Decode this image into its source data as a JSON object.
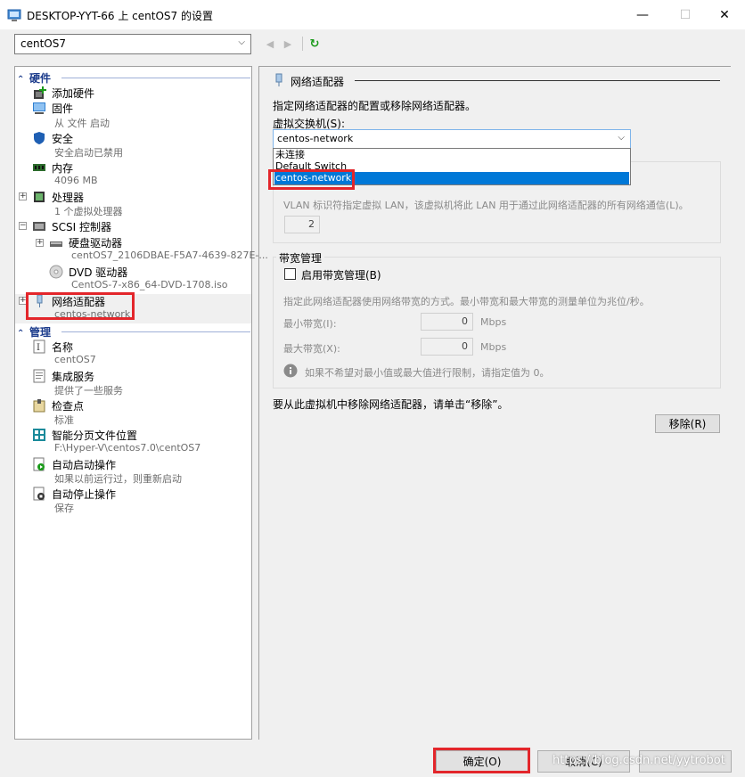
{
  "window": {
    "title": "DESKTOP-YYT-66 上 centOS7 的设置",
    "minimize": "—",
    "maximize": "☐",
    "close": "✕"
  },
  "toolbar": {
    "vm_name": "centOS7",
    "back": "◀",
    "forward": "▶",
    "refresh": "↻"
  },
  "left": {
    "hardware_header": "硬件",
    "management_header": "管理",
    "hardware_items": [
      {
        "label": "添加硬件",
        "sub": "",
        "icon": "add-hardware-icon"
      },
      {
        "label": "固件",
        "sub": "从 文件 启动",
        "icon": "firmware-icon"
      },
      {
        "label": "安全",
        "sub": "安全启动已禁用",
        "icon": "shield-icon"
      },
      {
        "label": "内存",
        "sub": "4096 MB",
        "icon": "memory-icon"
      },
      {
        "label": "处理器",
        "sub": "1 个虚拟处理器",
        "icon": "processor-icon"
      },
      {
        "label": "SCSI 控制器",
        "sub": "",
        "icon": "scsi-controller-icon"
      },
      {
        "label": "硬盘驱动器",
        "sub": "centOS7_2106DBAE-F5A7-4639-827E-...",
        "icon": "hard-drive-icon"
      },
      {
        "label": "DVD 驱动器",
        "sub": "CentOS-7-x86_64-DVD-1708.iso",
        "icon": "dvd-drive-icon"
      },
      {
        "label": "网络适配器",
        "sub": "centos-network",
        "icon": "network-adapter-icon"
      }
    ],
    "management_items": [
      {
        "label": "名称",
        "sub": "centOS7",
        "icon": "name-icon"
      },
      {
        "label": "集成服务",
        "sub": "提供了一些服务",
        "icon": "integration-services-icon"
      },
      {
        "label": "检查点",
        "sub": "标准",
        "icon": "checkpoint-icon"
      },
      {
        "label": "智能分页文件位置",
        "sub": "F:\\Hyper-V\\centos7.0\\centOS7",
        "icon": "paging-file-icon"
      },
      {
        "label": "自动启动操作",
        "sub": "如果以前运行过，则重新启动",
        "icon": "auto-start-icon"
      },
      {
        "label": "自动停止操作",
        "sub": "保存",
        "icon": "auto-stop-icon"
      }
    ]
  },
  "right": {
    "section_title": "网络适配器",
    "description": "指定网络适配器的配置或移除网络适配器。",
    "switch_label": "虚拟交换机(S):",
    "switch_value": "centos-network",
    "switch_options": [
      "未连接",
      "Default Switch",
      "centos-network"
    ],
    "vlan_text": "VLAN 标识符指定虚拟 LAN，该虚拟机将此 LAN 用于通过此网络适配器的所有网络通信(L)。",
    "vlan_value": "2",
    "bandwidth_title": "带宽管理",
    "bandwidth_checkbox": "启用带宽管理(B)",
    "bandwidth_desc": "指定此网络适配器使用网络带宽的方式。最小带宽和最大带宽的测量单位为兆位/秒。",
    "min_label": "最小带宽(I):",
    "min_value": "0",
    "max_label": "最大带宽(X):",
    "max_value": "0",
    "unit": "Mbps",
    "info_text": "如果不希望对最小值或最大值进行限制，请指定值为 0。",
    "remove_text": "要从此虚拟机中移除网络适配器，请单击“移除”。",
    "remove_button": "移除(R)"
  },
  "footer": {
    "ok": "确定(O)",
    "cancel": "取消(C)",
    "watermark": "https://blog.csdn.net/yytrobot"
  },
  "colors": {
    "accent": "#0078d7",
    "header_text": "#1c3c8c",
    "highlight": "#e3262b"
  }
}
